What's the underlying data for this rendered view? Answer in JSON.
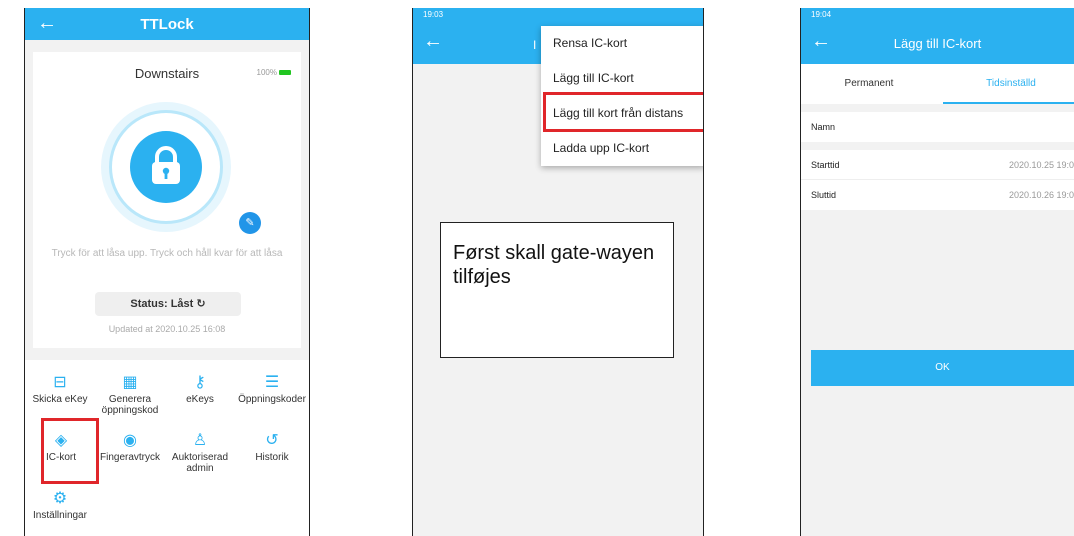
{
  "colors": {
    "accent": "#2bb1f0",
    "highlight": "#e0262a"
  },
  "screen1": {
    "title": "TTLock",
    "lock_name": "Downstairs",
    "battery": "100%",
    "hint": "Tryck för att låsa upp. Tryck och håll kvar för att låsa",
    "status": "Status:  Låst",
    "updated": "Updated at 2020.10.25 16:08",
    "grid": [
      {
        "label": "Skicka eKey",
        "icon": "ekey-send-icon"
      },
      {
        "label": "Generera öppningskod",
        "icon": "calculator-icon"
      },
      {
        "label": "eKeys",
        "icon": "keys-icon"
      },
      {
        "label": "Öppningskoder",
        "icon": "list-icon"
      },
      {
        "label": "IC-kort",
        "icon": "ic-card-icon"
      },
      {
        "label": "Fingeravtryck",
        "icon": "fingerprint-icon"
      },
      {
        "label": "Auktoriserad admin",
        "icon": "admin-icon"
      },
      {
        "label": "Historik",
        "icon": "history-icon"
      },
      {
        "label": "Inställningar",
        "icon": "settings-icon"
      }
    ]
  },
  "screen2": {
    "time": "19:03",
    "title": "I",
    "menu": [
      "Rensa IC-kort",
      "Lägg till IC-kort",
      "Lägg till kort från distans",
      "Ladda upp IC-kort"
    ],
    "note": "Først skall gate-wayen tilføjes"
  },
  "screen3": {
    "time": "19:04",
    "title": "Lägg till IC-kort",
    "tabs": [
      "Permanent",
      "Tidsinställd"
    ],
    "name_label": "Namn",
    "start_label": "Starttid",
    "start_value": "2020.10.25 19:0",
    "end_label": "Sluttid",
    "end_value": "2020.10.26 19:0",
    "ok": "OK"
  }
}
